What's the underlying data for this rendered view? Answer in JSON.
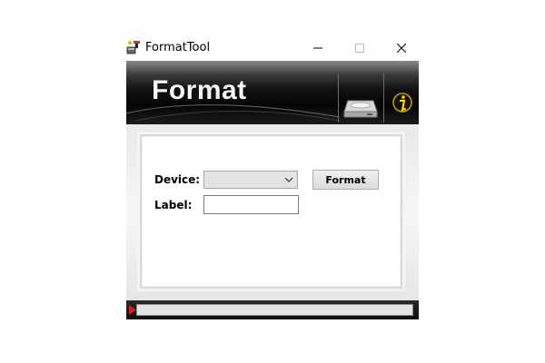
{
  "window": {
    "title": "FormatTool"
  },
  "titlebar": {
    "controls": [
      "minimize-icon",
      "maximize-icon",
      "close-icon"
    ]
  },
  "banner": {
    "title": "Format",
    "buttons": [
      "disk-icon",
      "info-icon"
    ]
  },
  "form": {
    "device_label": "Device:",
    "device_value": "",
    "label_label": "Label:",
    "label_value": "",
    "format_button": "Format"
  },
  "statusbar": {
    "progress": 0
  },
  "colors": {
    "banner_dark": "#0a0a0a",
    "panel_bg": "#ffffff",
    "frame_bg": "#ececec",
    "status_arrow": "#d02020"
  }
}
